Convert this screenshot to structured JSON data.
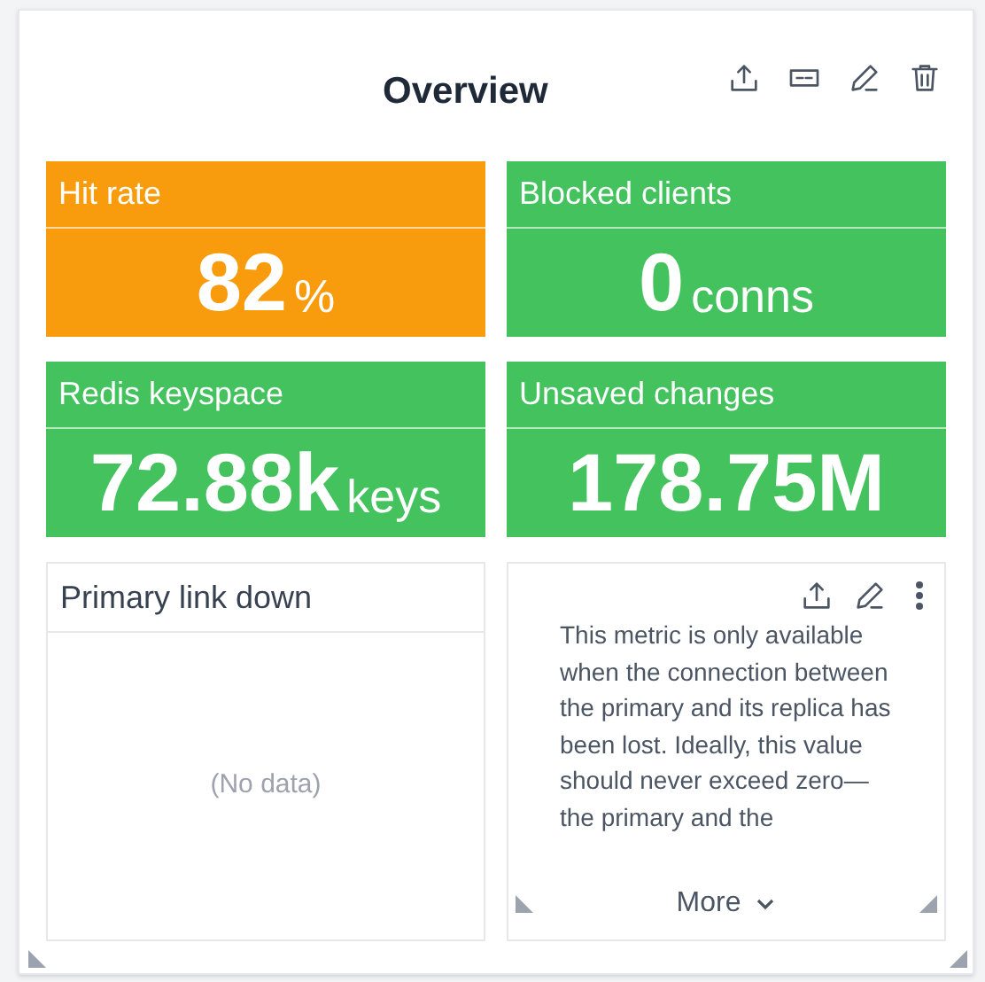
{
  "title": "Overview",
  "tiles": [
    {
      "label": "Hit rate",
      "value": "82",
      "unit": "%",
      "color": "#f89c0e"
    },
    {
      "label": "Blocked clients",
      "value": "0",
      "unit": "conns",
      "color": "#43c25e"
    },
    {
      "label": "Redis keyspace",
      "value": "72.88k",
      "unit": "keys",
      "color": "#43c25e"
    },
    {
      "label": "Unsaved changes",
      "value": "178.75M",
      "color": "#43c25e"
    }
  ],
  "chart_panel": {
    "title": "Primary link down",
    "empty_text": "(No data)"
  },
  "description_panel": {
    "text": "This metric is only available when the connection between the primary and its replica has been lost. Ideally, this value should never exceed zero—the primary and the",
    "more_button": "More"
  }
}
